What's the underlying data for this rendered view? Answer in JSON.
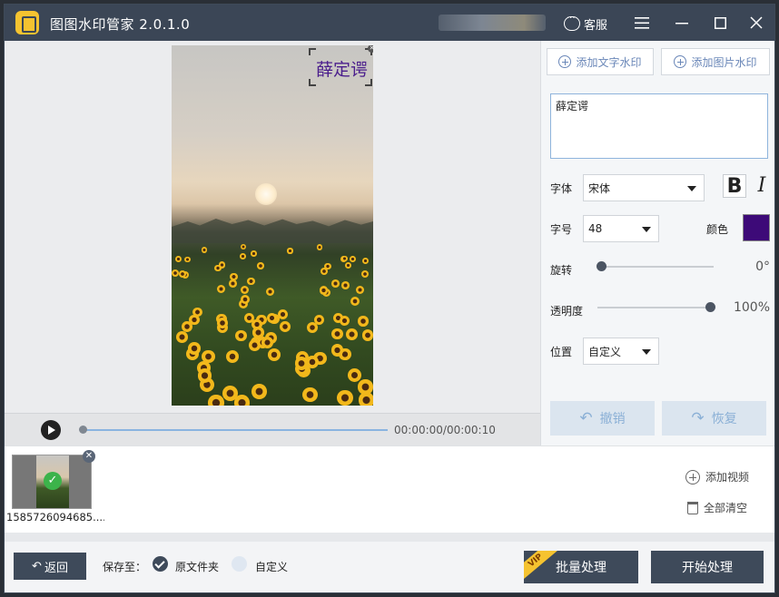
{
  "titlebar": {
    "app_title": "图图水印管家  2.0.1.0",
    "service_label": "客服",
    "icons": [
      "app-logo-icon",
      "chat-icon",
      "menu-icon",
      "minimize-icon",
      "maximize-icon",
      "close-icon"
    ]
  },
  "preview": {
    "watermark_text": "薛定谔",
    "time_display": "00:00:00/00:00:10",
    "progress_fraction": 0
  },
  "panel": {
    "add_text_watermark": "添加文字水印",
    "add_image_watermark": "添加图片水印",
    "watermark_input": "薛定谔",
    "font_label": "字体",
    "font_value": "宋体",
    "bold_glyph": "B",
    "italic_glyph": "I",
    "size_label": "字号",
    "size_value": "48",
    "color_label": "颜色",
    "color_value": "#3d0a78",
    "rotate_label": "旋转",
    "rotate_value": "0°",
    "rotate_fraction": 0,
    "opacity_label": "透明度",
    "opacity_value": "100%",
    "opacity_fraction": 1,
    "position_label": "位置",
    "position_value": "自定义",
    "undo_label": "撤销",
    "redo_label": "恢复"
  },
  "files": {
    "file_name": "1585726094685....",
    "add_video": "添加视频",
    "clear_all": "全部清空"
  },
  "bottom": {
    "back_label": "返回",
    "save_to_label": "保存至：",
    "option_original": "原文件夹",
    "option_custom": "自定义",
    "vip_badge": "VIP",
    "batch_label": "批量处理",
    "start_label": "开始处理"
  }
}
